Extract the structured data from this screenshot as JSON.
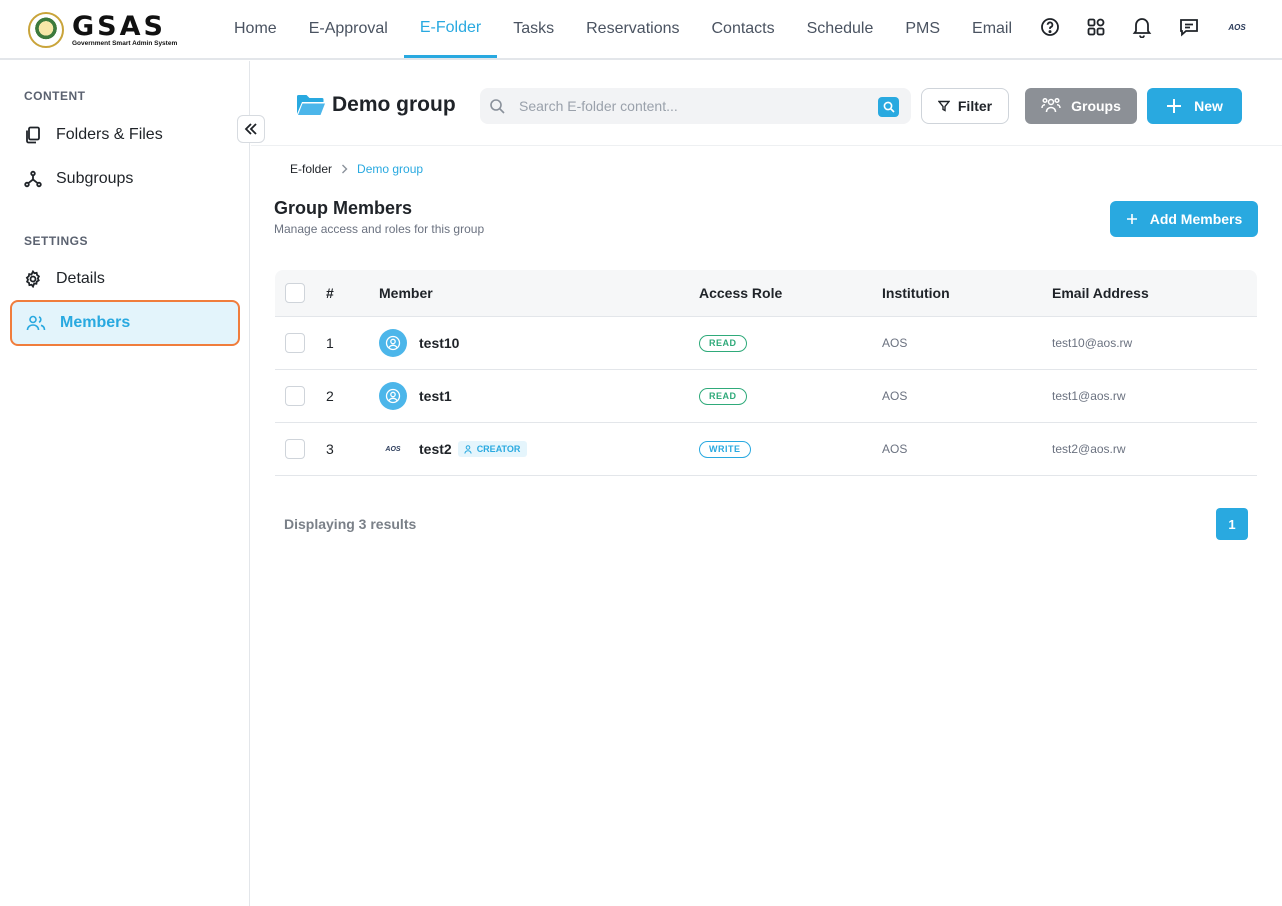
{
  "app": {
    "logo_text": "GSAS",
    "logo_subtitle": "Government Smart Admin System"
  },
  "nav": {
    "items": [
      {
        "label": "Home"
      },
      {
        "label": "E-Approval"
      },
      {
        "label": "E-Folder",
        "active": true
      },
      {
        "label": "Tasks"
      },
      {
        "label": "Reservations"
      },
      {
        "label": "Contacts"
      },
      {
        "label": "Schedule"
      },
      {
        "label": "PMS"
      },
      {
        "label": "Email"
      }
    ],
    "icons": [
      "help-circle-icon",
      "apps-grid-icon",
      "bell-icon",
      "message-icon",
      "aos-avatar"
    ],
    "user_logo": "AOS"
  },
  "sidebar": {
    "content_heading": "CONTENT",
    "content_items": [
      {
        "label": "Folders & Files",
        "icon": "files-icon"
      },
      {
        "label": "Subgroups",
        "icon": "branch-icon"
      }
    ],
    "settings_heading": "SETTINGS",
    "settings_items": [
      {
        "label": "Details",
        "icon": "gear-icon"
      },
      {
        "label": "Members",
        "icon": "users-icon",
        "active": true
      }
    ]
  },
  "header": {
    "title": "Demo group",
    "search_placeholder": "Search E-folder content...",
    "filter_label": "Filter",
    "groups_label": "Groups",
    "new_label": "New"
  },
  "breadcrumb": {
    "root": "E-folder",
    "current": "Demo group"
  },
  "section": {
    "title": "Group Members",
    "subtitle": "Manage access and roles for this group",
    "add_label": "Add Members"
  },
  "table": {
    "columns": {
      "num": "#",
      "member": "Member",
      "role": "Access Role",
      "institution": "Institution",
      "email": "Email Address"
    },
    "rows": [
      {
        "num": "1",
        "member": "test10",
        "role": "READ",
        "institution": "AOS",
        "email": "test10@aos.rw"
      },
      {
        "num": "2",
        "member": "test1",
        "role": "READ",
        "institution": "AOS",
        "email": "test1@aos.rw"
      },
      {
        "num": "3",
        "member": "test2",
        "badge": "CREATOR",
        "role": "WRITE",
        "institution": "AOS",
        "email": "test2@aos.rw"
      }
    ]
  },
  "footer": {
    "results_text": "Displaying 3 results",
    "page": "1"
  },
  "colors": {
    "accent": "#29a9e0",
    "active_outline": "#f07d3c",
    "read_badge": "#2faa7a",
    "groups_button": "#8c9096"
  }
}
